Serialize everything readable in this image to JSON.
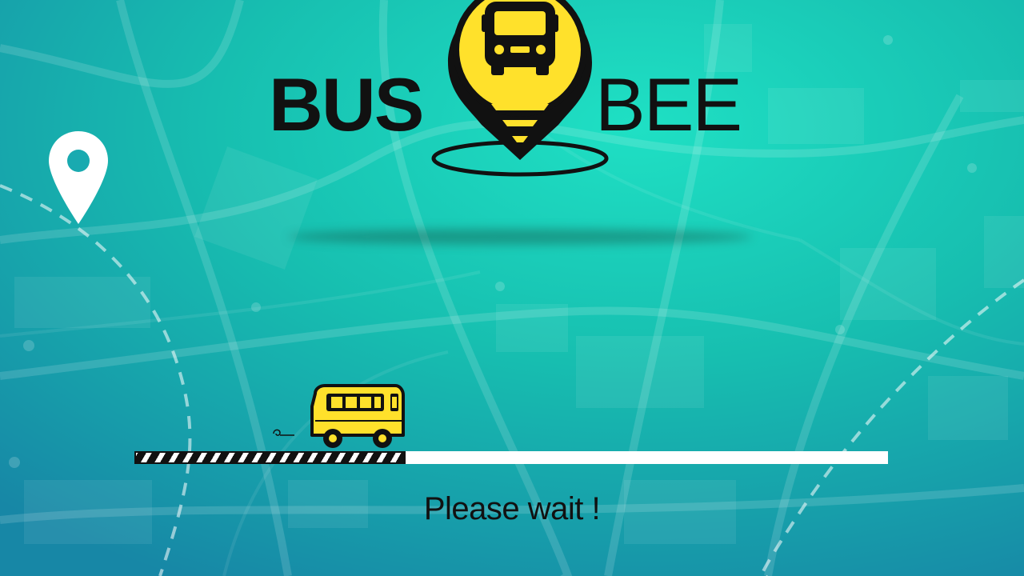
{
  "app": {
    "logo_left": "BUS",
    "logo_right": "BEE"
  },
  "loader": {
    "status_text": "Please wait !",
    "progress": 0.36
  },
  "icons": {
    "logo_pin": "bus-location-pin-icon",
    "map_pin": "map-pin-icon",
    "bus": "bus-icon"
  },
  "colors": {
    "background": "#18b3ad",
    "accent_yellow": "#ffe12b",
    "ink": "#111111"
  }
}
